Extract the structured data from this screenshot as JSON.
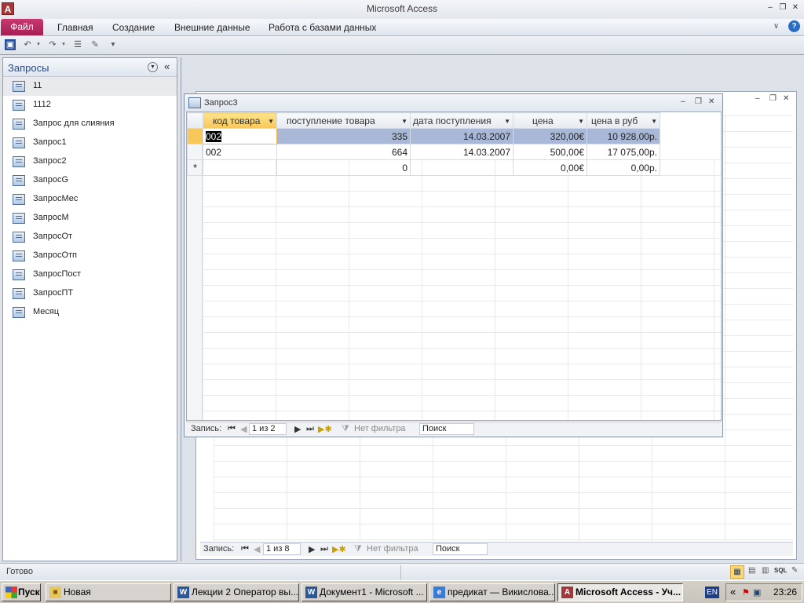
{
  "window": {
    "title": "Microsoft Access"
  },
  "ribbon": {
    "file": "Файл",
    "tabs": [
      "Главная",
      "Создание",
      "Внешние данные",
      "Работа с базами данных"
    ]
  },
  "nav": {
    "title": "Запросы",
    "items": [
      "11",
      "1112",
      "Запрос для слияния",
      "Запрос1",
      "Запрос2",
      "ЗапросG",
      "ЗапросМес",
      "ЗапросМ",
      "ЗапросОт",
      "ЗапросОтп",
      "ЗапросПост",
      "ЗапросПТ",
      "Месяц"
    ]
  },
  "query": {
    "title": "Запрос3",
    "columns": [
      "код товара",
      "поступление товара",
      "дата поступления",
      "цена",
      "цена в руб"
    ],
    "rows": [
      [
        "002",
        "335",
        "14.03.2007",
        "320,00€",
        "10 928,00р."
      ],
      [
        "002",
        "664",
        "14.03.2007",
        "500,00€",
        "17 075,00р."
      ]
    ],
    "new_row": {
      "marker": "*",
      "values": [
        "",
        "0",
        "",
        "0,00€",
        "0,00р."
      ]
    },
    "nav": {
      "label": "Запись:",
      "position": "1 из 2",
      "filter": "Нет фильтра",
      "search": "Поиск"
    }
  },
  "back_window": {
    "nav": {
      "label": "Запись:",
      "position": "1 из 8",
      "filter": "Нет фильтра",
      "search": "Поиск"
    }
  },
  "status": {
    "text": "Готово"
  },
  "taskbar": {
    "start": "Пуск",
    "items": [
      "Новая",
      "Лекции 2 Оператор вы...",
      "Документ1 - Microsoft ...",
      "предикат — Викислова...",
      "Microsoft Access - Уч..."
    ],
    "lang": "EN",
    "time": "23:26"
  },
  "colors": {
    "file_tab": "#a41f52",
    "selected_row": "#a9b8d6",
    "active_cell_border": "#f0b54a"
  }
}
